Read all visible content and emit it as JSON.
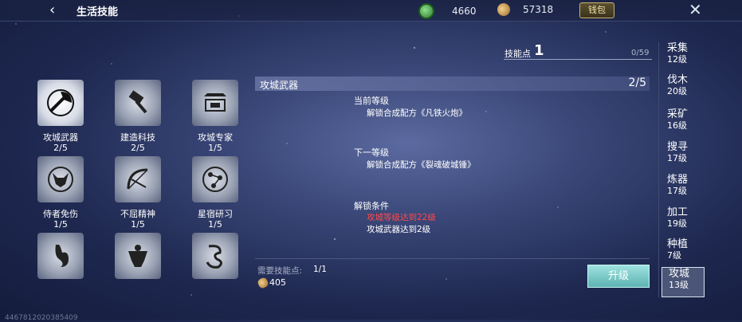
{
  "header": {
    "title": "生活技能",
    "jade": "4660",
    "gold": "57318",
    "wallet_label": "钱包"
  },
  "skill_points": {
    "label": "技能点",
    "value": "1",
    "progress": "0/59"
  },
  "skills": [
    {
      "name": "攻城武器",
      "level": "2/5",
      "icon": "axe-icon"
    },
    {
      "name": "建造科技",
      "level": "2/5",
      "icon": "hammer-icon"
    },
    {
      "name": "攻城专家",
      "level": "1/5",
      "icon": "fortress-icon"
    },
    {
      "name": "侍者免伤",
      "level": "1/5",
      "icon": "fox-mask-icon"
    },
    {
      "name": "不屈精神",
      "level": "1/5",
      "icon": "bow-icon"
    },
    {
      "name": "星宿研习",
      "level": "1/5",
      "icon": "constellation-icon"
    },
    {
      "name": "",
      "level": "",
      "icon": "stomach-icon"
    },
    {
      "name": "",
      "level": "",
      "icon": "muscle-icon"
    },
    {
      "name": "",
      "level": "",
      "icon": "dragon-icon"
    }
  ],
  "detail": {
    "name": "攻城武器",
    "progress": "2/5",
    "current_title": "当前等级",
    "current_desc": "解锁合成配方《凡铁火炮》",
    "next_title": "下一等级",
    "next_desc": "解锁合成配方《裂魂破城锤》",
    "unlock_title": "解锁条件",
    "unlock_cond1": "攻城等级达到22级",
    "unlock_cond2": "攻城武器达到2级",
    "req_label": "需要技能点:",
    "req_value": "1/1",
    "cost": "405",
    "upgrade_label": "升级"
  },
  "tabs": [
    {
      "title": "采集",
      "level": "12级"
    },
    {
      "title": "伐木",
      "level": "20级"
    },
    {
      "title": "采矿",
      "level": "16级"
    },
    {
      "title": "搜寻",
      "level": "17级"
    },
    {
      "title": "炼器",
      "level": "17级"
    },
    {
      "title": "加工",
      "level": "19级"
    },
    {
      "title": "种植",
      "level": "7级"
    },
    {
      "title": "攻城",
      "level": "13级"
    }
  ],
  "footer_id": "4467812020385409",
  "colors": {
    "accent": "#6fc7c5",
    "warning": "#ff4848"
  }
}
